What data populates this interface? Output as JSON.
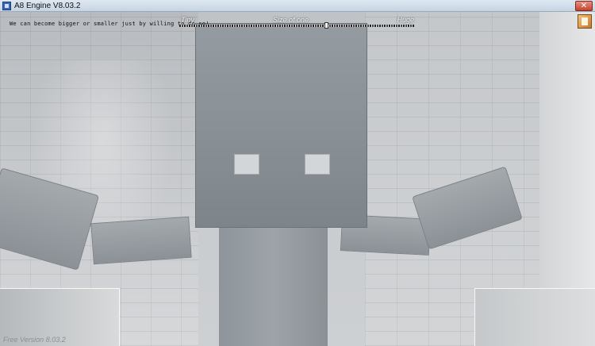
{
  "window": {
    "title": "A8 Engine V8.03.2",
    "close_label": "✕"
  },
  "hud": {
    "hint": "We can become bigger or smaller just by willing to do so!",
    "size_slider": {
      "min_label": "Tiny",
      "mid_label": "Size of one",
      "max_label": "Huge",
      "value_fraction": 0.63
    },
    "watermark": "Free Version 8.03.2"
  },
  "icons": {
    "app": "app-icon",
    "corner": "settings-icon"
  }
}
